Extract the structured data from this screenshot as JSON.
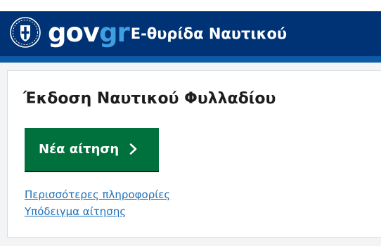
{
  "header": {
    "logo_gov": "gov",
    "logo_gr": "gr",
    "service_name": "E-θυρίδα Ναυτικού",
    "emblem_icon": "greek-coat-of-arms-icon",
    "background_color": "#003375",
    "accent_color": "#3f9fe0"
  },
  "main": {
    "title": "Έκδοση Ναυτικού Φυλλαδίου",
    "start_button": {
      "label": "Νέα αίτηση",
      "icon": "chevron-right-icon",
      "color": "#00703c"
    },
    "links": [
      {
        "label": "Περισσότερες πληροφορίες"
      },
      {
        "label": "Υπόδειγμα αίτησης"
      }
    ],
    "link_color": "#1d70b8"
  }
}
